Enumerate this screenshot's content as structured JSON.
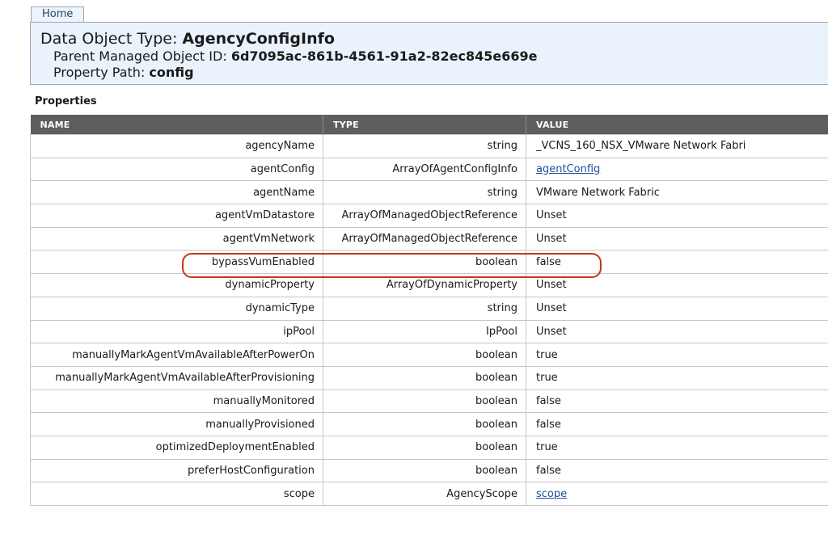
{
  "nav": {
    "home_label": "Home"
  },
  "header": {
    "type_label": "Data Object Type: ",
    "type_value": "AgencyConfigInfo",
    "parent_label": "Parent Managed Object ID: ",
    "parent_value": "6d7095ac-861b-4561-91a2-82ec845e669e",
    "path_label": "Property Path: ",
    "path_value": "config"
  },
  "properties": {
    "title": "Properties",
    "columns": [
      "NAME",
      "TYPE",
      "VALUE"
    ],
    "rows": [
      {
        "name": "agencyName",
        "type": "string",
        "value": "_VCNS_160_NSX_VMware Network Fabri",
        "link": false
      },
      {
        "name": "agentConfig",
        "type": "ArrayOfAgentConfigInfo",
        "value": "agentConfig",
        "link": true
      },
      {
        "name": "agentName",
        "type": "string",
        "value": "VMware Network Fabric",
        "link": false
      },
      {
        "name": "agentVmDatastore",
        "type": "ArrayOfManagedObjectReference",
        "value": "Unset",
        "link": false
      },
      {
        "name": "agentVmNetwork",
        "type": "ArrayOfManagedObjectReference",
        "value": "Unset",
        "link": false
      },
      {
        "name": "bypassVumEnabled",
        "type": "boolean",
        "value": "false",
        "link": false
      },
      {
        "name": "dynamicProperty",
        "type": "ArrayOfDynamicProperty",
        "value": "Unset",
        "link": false
      },
      {
        "name": "dynamicType",
        "type": "string",
        "value": "Unset",
        "link": false
      },
      {
        "name": "ipPool",
        "type": "IpPool",
        "value": "Unset",
        "link": false
      },
      {
        "name": "manuallyMarkAgentVmAvailableAfterPowerOn",
        "type": "boolean",
        "value": "true",
        "link": false
      },
      {
        "name": "manuallyMarkAgentVmAvailableAfterProvisioning",
        "type": "boolean",
        "value": "true",
        "link": false
      },
      {
        "name": "manuallyMonitored",
        "type": "boolean",
        "value": "false",
        "link": false
      },
      {
        "name": "manuallyProvisioned",
        "type": "boolean",
        "value": "false",
        "link": false
      },
      {
        "name": "optimizedDeploymentEnabled",
        "type": "boolean",
        "value": "true",
        "link": false
      },
      {
        "name": "preferHostConfiguration",
        "type": "boolean",
        "value": "false",
        "link": false
      },
      {
        "name": "scope",
        "type": "AgencyScope",
        "value": "scope",
        "link": true
      }
    ]
  },
  "colors": {
    "header_bg": "#eaf3fb",
    "table_header_bg": "#5e5e5e",
    "link": "#1d4e9a",
    "highlight": "#c8341f"
  }
}
